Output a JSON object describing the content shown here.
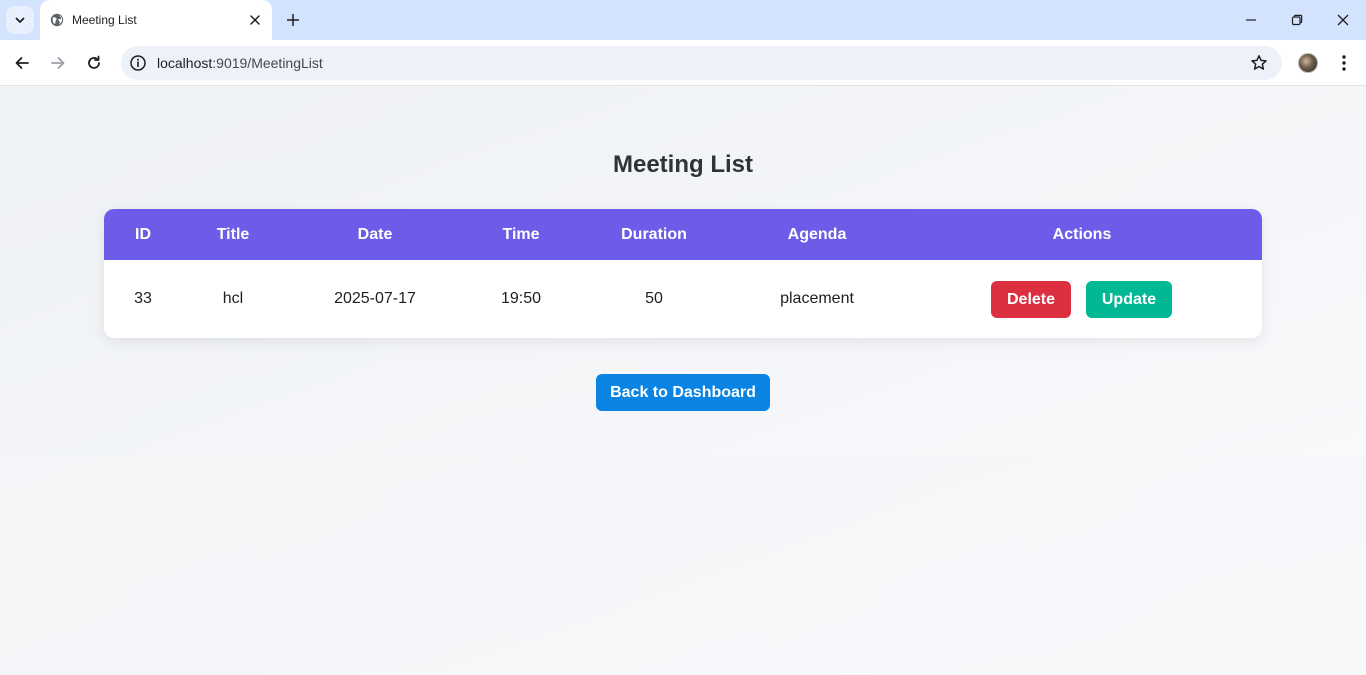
{
  "browser": {
    "tab_title": "Meeting List",
    "url_host": "localhost",
    "url_path": ":9019/MeetingList"
  },
  "page": {
    "title": "Meeting List",
    "columns": {
      "id": "ID",
      "title": "Title",
      "date": "Date",
      "time": "Time",
      "duration": "Duration",
      "agenda": "Agenda",
      "actions": "Actions"
    },
    "rows": [
      {
        "id": "33",
        "title": "hcl",
        "date": "2025-07-17",
        "time": "19:50",
        "duration": "50",
        "agenda": "placement",
        "delete_label": "Delete",
        "update_label": "Update"
      }
    ],
    "back_label": "Back to Dashboard"
  },
  "colors": {
    "header_bg": "#6c5ce7",
    "delete_bg": "#dc3040",
    "update_bg": "#00b894",
    "back_bg": "#0984e3"
  }
}
